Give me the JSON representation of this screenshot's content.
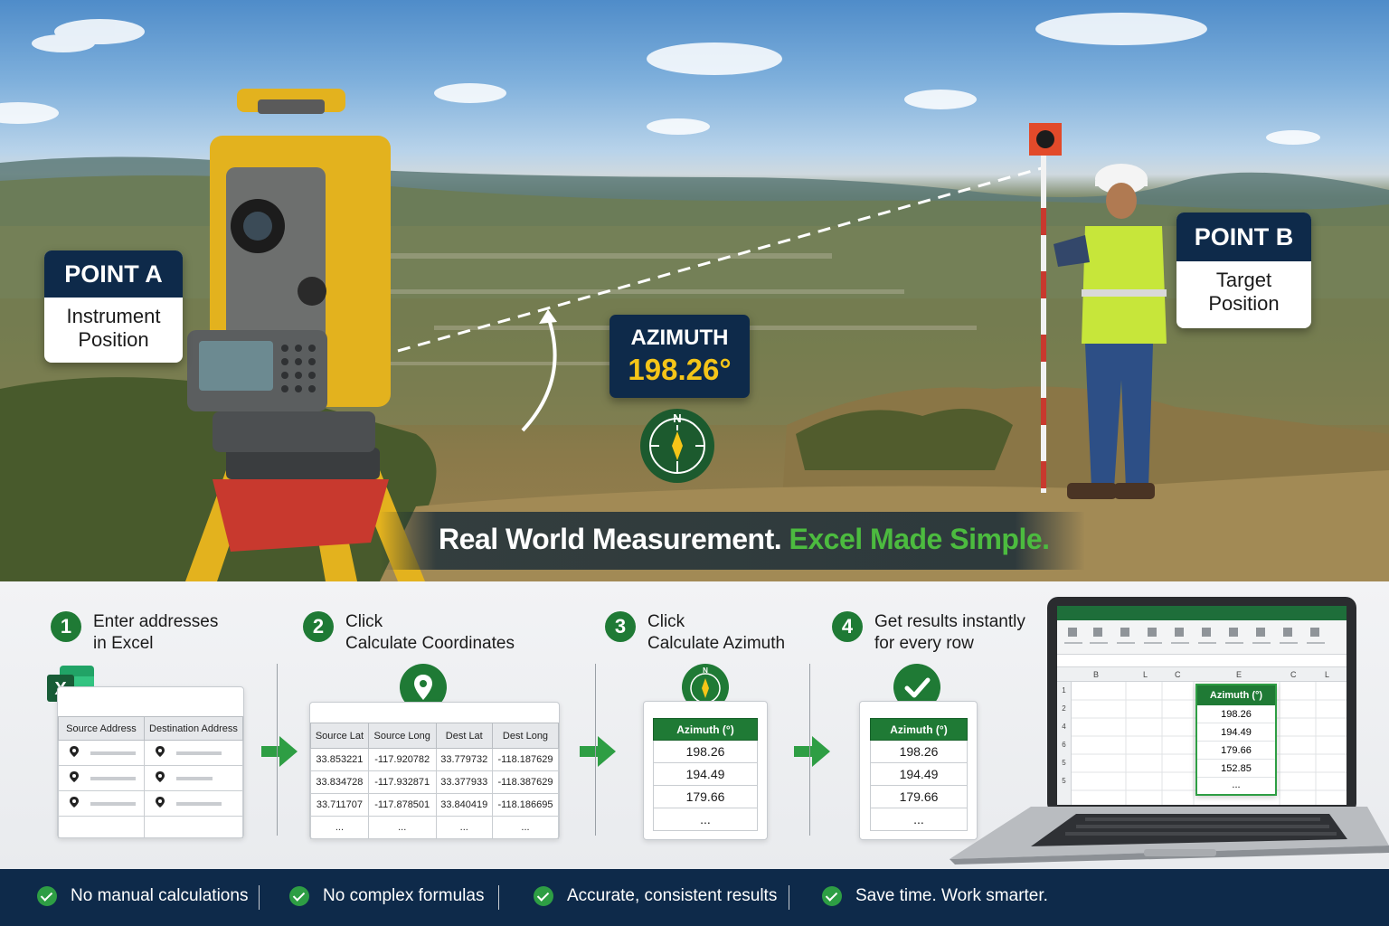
{
  "hero": {
    "point_a": {
      "title": "POINT A",
      "line1": "Instrument",
      "line2": "Position"
    },
    "point_b": {
      "title": "POINT B",
      "line1": "Target",
      "line2": "Position"
    },
    "azimuth": {
      "label": "AZIMUTH",
      "value": "198.26°",
      "compass_letter": "N"
    },
    "banner": {
      "part1": "Real World Measurement.",
      "part2": "Excel Made Simple."
    }
  },
  "steps": [
    {
      "number": "1",
      "line1": "Enter addresses",
      "line2": "in Excel"
    },
    {
      "number": "2",
      "line1": "Click",
      "line2": "Calculate Coordinates"
    },
    {
      "number": "3",
      "line1": "Click",
      "line2": "Calculate Azimuth"
    },
    {
      "number": "4",
      "line1": "Get results instantly",
      "line2": "for every row"
    }
  ],
  "address_table": {
    "excel_letter": "X",
    "headers": [
      "Source Address",
      "Destination Address"
    ]
  },
  "coord_table": {
    "headers": [
      "Source Lat",
      "Source Long",
      "Dest Lat",
      "Dest Long"
    ],
    "rows": [
      [
        "33.853221",
        "-117.920782",
        "33.779732",
        "-118.187629"
      ],
      [
        "33.834728",
        "-117.932871",
        "33.377933",
        "-118.387629"
      ],
      [
        "33.711707",
        "-117.878501",
        "33.840419",
        "-118.186695"
      ],
      [
        "...",
        "...",
        "...",
        "..."
      ]
    ]
  },
  "azimuth_table": {
    "header": "Azimuth (°)",
    "values": [
      "198.26",
      "194.49",
      "179.66",
      "..."
    ],
    "compass_letter": "N"
  },
  "result_table": {
    "header": "Azimuth (°)",
    "values": [
      "198.26",
      "194.49",
      "179.66",
      "..."
    ]
  },
  "laptop": {
    "col_headers": [
      "B",
      "L",
      "C",
      "E",
      "C",
      "L"
    ],
    "row_numbers": [
      "1",
      "2",
      "4",
      "6",
      "5",
      "5"
    ],
    "result_header": "Azimuth (°)",
    "result_values": [
      "198.26",
      "194.49",
      "179.66",
      "152.85",
      "..."
    ]
  },
  "benefits": [
    "No manual calculations",
    "No complex formulas",
    "Accurate, consistent results",
    "Save time. Work smarter."
  ],
  "colors": {
    "navy": "#0e2a4a",
    "green": "#1f7a35",
    "accent_green": "#4cbb3f",
    "gold": "#f5c518"
  }
}
